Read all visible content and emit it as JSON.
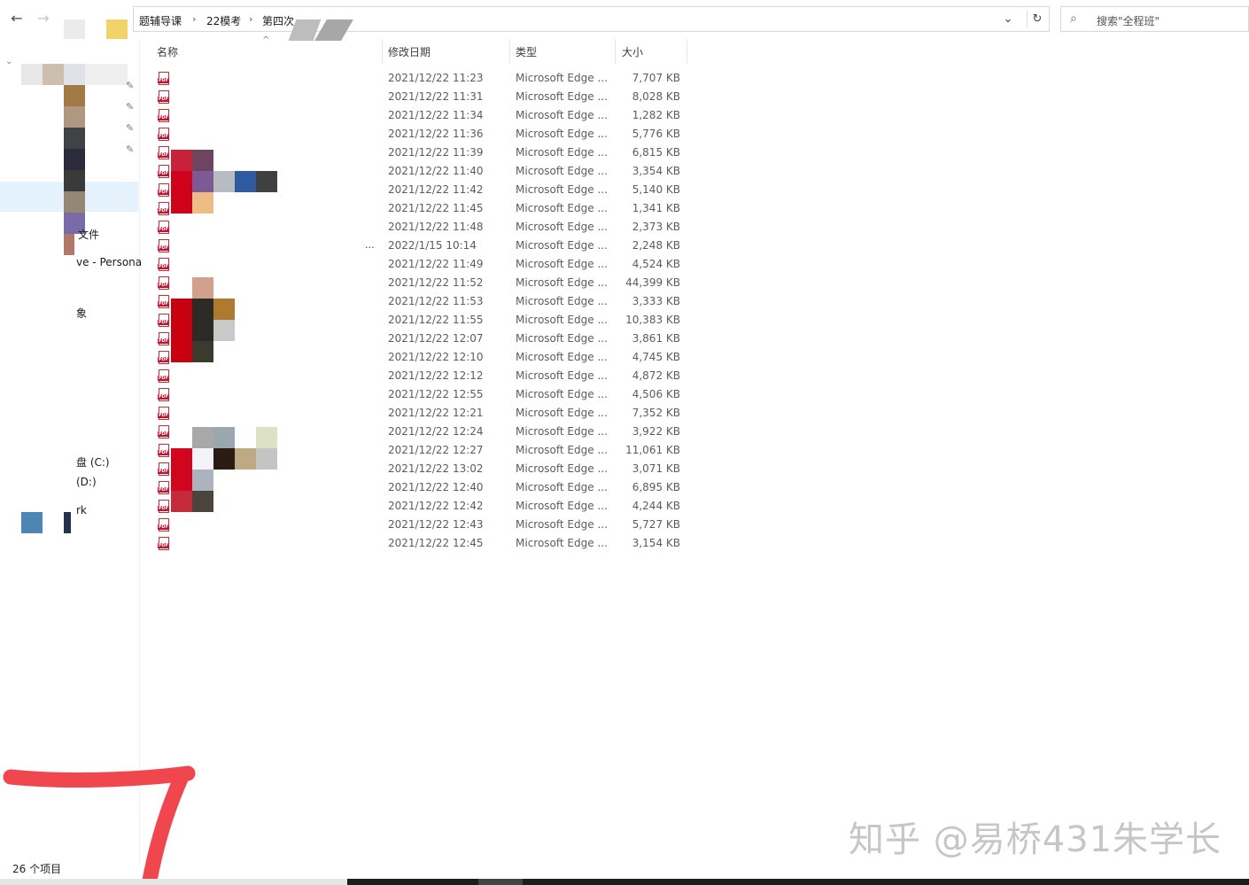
{
  "toolbar": {
    "back_icon": "←",
    "forward_icon": "→",
    "breadcrumbs": [
      "题辅导课",
      "22模考",
      "第四次"
    ],
    "dropdown_icon": "⌄",
    "refresh_icon": "↻"
  },
  "search": {
    "icon": "⌕",
    "placeholder": "搜索\"全程班\""
  },
  "nav": {
    "items": [
      {
        "label": "文件"
      },
      {
        "label": "ve - Persona"
      },
      {
        "label": "象"
      },
      {
        "label": "盘 (C:)"
      },
      {
        "label": "(D:)"
      },
      {
        "label": "rk"
      }
    ],
    "pin_icon": "📌"
  },
  "columns": {
    "name": "名称",
    "date": "修改日期",
    "type": "类型",
    "size": "大小",
    "sort_icon": "^"
  },
  "files": [
    {
      "date": "2021/12/22 11:23",
      "type": "Microsoft Edge ...",
      "size": "7,707 KB"
    },
    {
      "date": "2021/12/22 11:31",
      "type": "Microsoft Edge ...",
      "size": "8,028 KB"
    },
    {
      "date": "2021/12/22 11:34",
      "type": "Microsoft Edge ...",
      "size": "1,282 KB"
    },
    {
      "date": "2021/12/22 11:36",
      "type": "Microsoft Edge ...",
      "size": "5,776 KB"
    },
    {
      "date": "2021/12/22 11:39",
      "type": "Microsoft Edge ...",
      "size": "6,815 KB"
    },
    {
      "date": "2021/12/22 11:40",
      "type": "Microsoft Edge ...",
      "size": "3,354 KB"
    },
    {
      "date": "2021/12/22 11:42",
      "type": "Microsoft Edge ...",
      "size": "5,140 KB"
    },
    {
      "date": "2021/12/22 11:45",
      "type": "Microsoft Edge ...",
      "size": "1,341 KB"
    },
    {
      "date": "2021/12/22 11:48",
      "type": "Microsoft Edge ...",
      "size": "2,373 KB"
    },
    {
      "date": "2022/1/15 10:14",
      "type": "Microsoft Edge ...",
      "size": "2,248 KB"
    },
    {
      "date": "2021/12/22 11:49",
      "type": "Microsoft Edge ...",
      "size": "4,524 KB"
    },
    {
      "date": "2021/12/22 11:52",
      "type": "Microsoft Edge ...",
      "size": "44,399 KB"
    },
    {
      "date": "2021/12/22 11:53",
      "type": "Microsoft Edge ...",
      "size": "3,333 KB"
    },
    {
      "date": "2021/12/22 11:55",
      "type": "Microsoft Edge ...",
      "size": "10,383 KB"
    },
    {
      "date": "2021/12/22 12:07",
      "type": "Microsoft Edge ...",
      "size": "3,861 KB"
    },
    {
      "date": "2021/12/22 12:10",
      "type": "Microsoft Edge ...",
      "size": "4,745 KB"
    },
    {
      "date": "2021/12/22 12:12",
      "type": "Microsoft Edge ...",
      "size": "4,872 KB"
    },
    {
      "date": "2021/12/22 12:55",
      "type": "Microsoft Edge ...",
      "size": "4,506 KB"
    },
    {
      "date": "2021/12/22 12:21",
      "type": "Microsoft Edge ...",
      "size": "7,352 KB"
    },
    {
      "date": "2021/12/22 12:24",
      "type": "Microsoft Edge ...",
      "size": "3,922 KB"
    },
    {
      "date": "2021/12/22 12:27",
      "type": "Microsoft Edge ...",
      "size": "11,061 KB"
    },
    {
      "date": "2021/12/22 13:02",
      "type": "Microsoft Edge ...",
      "size": "3,071 KB"
    },
    {
      "date": "2021/12/22 12:40",
      "type": "Microsoft Edge ...",
      "size": "6,895 KB"
    },
    {
      "date": "2021/12/22 12:42",
      "type": "Microsoft Edge ...",
      "size": "4,244 KB"
    },
    {
      "date": "2021/12/22 12:43",
      "type": "Microsoft Edge ...",
      "size": "5,727 KB"
    },
    {
      "date": "2021/12/22 12:45",
      "type": "Microsoft Edge ...",
      "size": "3,154 KB"
    }
  ],
  "truncation_mark": "...",
  "status": {
    "item_count": "26 个项目"
  },
  "watermark": "知乎 @易桥431朱学长",
  "colors": {
    "pdf_red": "#c8102e",
    "annotation_red": "#f0474f",
    "row_text": "#5c5c5c"
  }
}
